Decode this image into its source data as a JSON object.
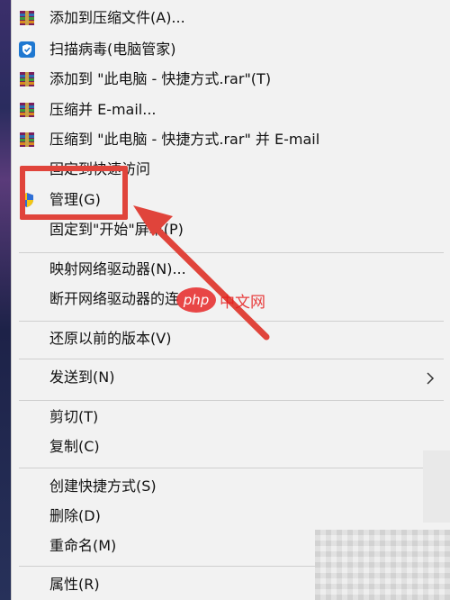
{
  "menu": {
    "items": [
      {
        "id": "add-archive",
        "label": "添加到压缩文件(A)...",
        "icon": "winrar-icon"
      },
      {
        "id": "scan-virus",
        "label": "扫描病毒(电脑管家)",
        "icon": "shield-icon"
      },
      {
        "id": "add-rar",
        "label": "添加到 \"此电脑 - 快捷方式.rar\"(T)",
        "icon": "winrar-icon"
      },
      {
        "id": "compress-email",
        "label": "压缩并 E-mail...",
        "icon": "winrar-icon"
      },
      {
        "id": "compress-rar-email",
        "label": "压缩到 \"此电脑 - 快捷方式.rar\" 并 E-mail",
        "icon": "winrar-icon"
      },
      {
        "id": "pin-quick-access",
        "label": "固定到快速访问",
        "icon": ""
      },
      {
        "id": "manage",
        "label": "管理(G)",
        "icon": "uac-shield-icon"
      },
      {
        "id": "pin-start",
        "label": "固定到\"开始\"屏幕(P)",
        "icon": ""
      },
      {
        "id": "map-drive",
        "label": "映射网络驱动器(N)...",
        "icon": ""
      },
      {
        "id": "disconnect-drive",
        "label": "断开网络驱动器的连",
        "icon": ""
      },
      {
        "id": "restore-versions",
        "label": "还原以前的版本(V)",
        "icon": ""
      },
      {
        "id": "send-to",
        "label": "发送到(N)",
        "icon": "",
        "submenu": true
      },
      {
        "id": "cut",
        "label": "剪切(T)",
        "icon": ""
      },
      {
        "id": "copy",
        "label": "复制(C)",
        "icon": ""
      },
      {
        "id": "create-shortcut",
        "label": "创建快捷方式(S)",
        "icon": ""
      },
      {
        "id": "delete",
        "label": "删除(D)",
        "icon": ""
      },
      {
        "id": "rename",
        "label": "重命名(M)",
        "icon": ""
      },
      {
        "id": "properties",
        "label": "属性(R)",
        "icon": ""
      }
    ]
  },
  "watermark": {
    "logo": "php",
    "text": "中文网"
  },
  "colors": {
    "highlight": "#e0443b",
    "menu_bg": "#f2f2f2",
    "separator": "#cfcfcf"
  }
}
